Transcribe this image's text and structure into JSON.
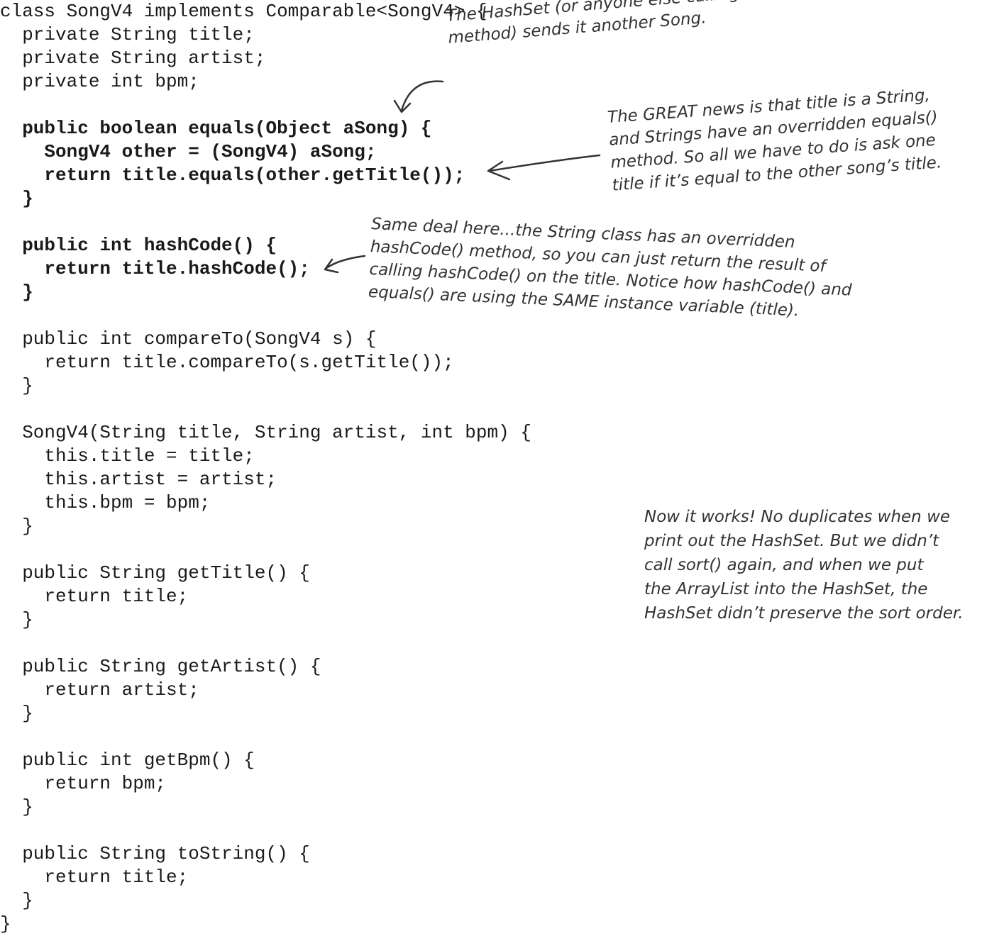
{
  "code": {
    "lines": [
      {
        "text": "class SongV4 implements Comparable<SongV4> {",
        "bold": false
      },
      {
        "text": "  private String title;",
        "bold": false
      },
      {
        "text": "  private String artist;",
        "bold": false
      },
      {
        "text": "  private int bpm;",
        "bold": false
      },
      {
        "text": "",
        "bold": false
      },
      {
        "text": "  public boolean equals(Object aSong) {",
        "bold": true
      },
      {
        "text": "    SongV4 other = (SongV4) aSong;",
        "bold": true
      },
      {
        "text": "    return title.equals(other.getTitle());",
        "bold": true
      },
      {
        "text": "  }",
        "bold": true
      },
      {
        "text": "",
        "bold": false
      },
      {
        "text": "  public int hashCode() {",
        "bold": true
      },
      {
        "text": "    return title.hashCode();",
        "bold": true
      },
      {
        "text": "  }",
        "bold": true
      },
      {
        "text": "",
        "bold": false
      },
      {
        "text": "  public int compareTo(SongV4 s) {",
        "bold": false
      },
      {
        "text": "    return title.compareTo(s.getTitle());",
        "bold": false
      },
      {
        "text": "  }",
        "bold": false
      },
      {
        "text": "",
        "bold": false
      },
      {
        "text": "  SongV4(String title, String artist, int bpm) {",
        "bold": false
      },
      {
        "text": "    this.title = title;",
        "bold": false
      },
      {
        "text": "    this.artist = artist;",
        "bold": false
      },
      {
        "text": "    this.bpm = bpm;",
        "bold": false
      },
      {
        "text": "  }",
        "bold": false
      },
      {
        "text": "",
        "bold": false
      },
      {
        "text": "  public String getTitle() {",
        "bold": false
      },
      {
        "text": "    return title;",
        "bold": false
      },
      {
        "text": "  }",
        "bold": false
      },
      {
        "text": "",
        "bold": false
      },
      {
        "text": "  public String getArtist() {",
        "bold": false
      },
      {
        "text": "    return artist;",
        "bold": false
      },
      {
        "text": "  }",
        "bold": false
      },
      {
        "text": "",
        "bold": false
      },
      {
        "text": "  public int getBpm() {",
        "bold": false
      },
      {
        "text": "    return bpm;",
        "bold": false
      },
      {
        "text": "  }",
        "bold": false
      },
      {
        "text": "",
        "bold": false
      },
      {
        "text": "  public String toString() {",
        "bold": false
      },
      {
        "text": "    return title;",
        "bold": false
      },
      {
        "text": "  }",
        "bold": false
      },
      {
        "text": "}",
        "bold": false
      }
    ]
  },
  "annotations": {
    "hashset_note": [
      "The HashSet (or anyone else calling this",
      "method) sends it another Song."
    ],
    "great_news_note": [
      "The GREAT news is that title is a String,",
      "and Strings have an overridden equals()",
      "method. So all we have to do is ask one",
      "title if it’s equal to the other song’s title."
    ],
    "same_deal_note": [
      "Same deal here...the String class has an overridden",
      "hashCode() method, so you can just return the result of",
      "calling hashCode() on the title. Notice how hashCode() and",
      "equals() are using the SAME instance variable (title)."
    ],
    "now_it_works_note": [
      "Now it works! No duplicates when we",
      "print out the HashSet. But we didn’t",
      "call sort() again, and when we put",
      "the ArrayList into the HashSet, the",
      "HashSet didn’t preserve the sort order."
    ]
  }
}
